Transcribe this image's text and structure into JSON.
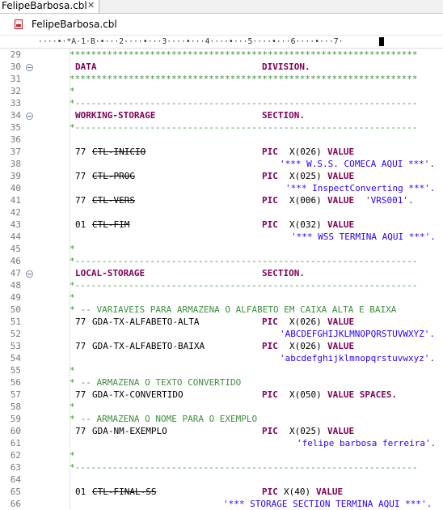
{
  "tab": {
    "title": "FelipeBarbosa.cbl",
    "close": "✕"
  },
  "breadcrumb": {
    "label": "FelipeBarbosa.cbl"
  },
  "ruler": {
    "text": "····•·*A·1·B·•···2····•···3····•···4····•···5····•···6····•···7·"
  },
  "line_numbers": [
    "29",
    "30",
    "31",
    "32",
    "33",
    "34",
    "35",
    "36",
    "37",
    "38",
    "39",
    "40",
    "41",
    "42",
    "43",
    "44",
    "45",
    "46",
    "47",
    "48",
    "49",
    "50",
    "51",
    "52",
    "53",
    "54",
    "55",
    "56",
    "57",
    "58",
    "59",
    "60",
    "61",
    "62",
    "63",
    "64",
    "65",
    "66"
  ],
  "code": {
    "stars": "*****************************************************************",
    "dashes": "*----------------------------------------------------------------",
    "star": "*",
    "data_div": "DATA",
    "division": "DIVISION.",
    "ws": "WORKING-STORAGE",
    "section": "SECTION.",
    "ls": "LOCAL-STORAGE",
    "lvl77": "77",
    "lvl01": "01",
    "pic": "PIC",
    "value": "VALUE",
    "ctl_inicio": "CTL-INICIO",
    "x026": "X(026)",
    "wss_comeca": "'*** W.S.S. COMECA AQUI ***'.",
    "ctl_prog": "CTL-PROG",
    "x025": "X(025)",
    "inspect": "'*** InspectConverting ***'.",
    "ctl_vers": "CTL-VERS",
    "x006": "X(006)",
    "vrs": "'VRS001'.",
    "ctl_fim": "CTL-FIM",
    "x032": "X(032)",
    "wss_termina": "'*** WSS TERMINA AQUI ***'.",
    "c_variaveis": " -- VARIAVEIS PARA ARMAZENA O ALFABETO EM CAIXA ALTA E BAIXA",
    "alfa_alta": "GDA-TX-ALFABETO-ALTA",
    "upper": "'ABCDEFGHIJKLMNOPQRSTUVWXYZ'.",
    "alfa_baixa": "GDA-TX-ALFABETO-BAIXA",
    "lower": "'abcdefghijklmnopqrstuvwxyz'.",
    "c_texto": " -- ARMAZENA O TEXTO CONVERTIDO",
    "convertido": "GDA-TX-CONVERTIDO",
    "x050": "X(050)",
    "spaces": "VALUE SPACES.",
    "c_nome": " -- ARMAZENA O NOME PARA O EXEMPLO",
    "nm_exemplo": "GDA-NM-EXEMPLO",
    "felipe": "'felipe barbosa ferreira'.",
    "ctl_final_ss": "CTL-FINAL-SS",
    "x40": "X(40)",
    "storage_termina": "'*** STORAGE SECTION TERMINA AQUI ***'."
  }
}
